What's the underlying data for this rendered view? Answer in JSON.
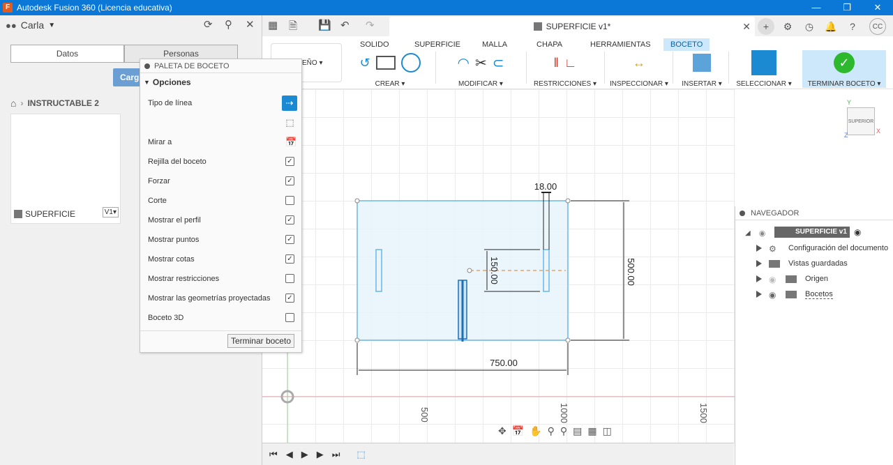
{
  "window": {
    "title": "Autodesk Fusion 360 (Licencia educativa)",
    "logo": "F",
    "minimize": "—",
    "maximize": "❐",
    "close": "✕"
  },
  "left_panel": {
    "user": "Carla",
    "tabs": [
      "Datos",
      "Personas"
    ],
    "upload_label": "Carg",
    "breadcrumb": "INSTRUCTABLE 2",
    "card": {
      "name": "SUPERFICIE",
      "version": "V1▾"
    }
  },
  "palette": {
    "title": "PALETA DE BOCETO",
    "section": "Opciones",
    "rows": [
      {
        "label": "Tipo de línea",
        "state": "button"
      },
      {
        "label": "",
        "state": "icon"
      },
      {
        "label": "Mirar a",
        "state": "icon"
      },
      {
        "label": "Rejilla del boceto",
        "state": "checked"
      },
      {
        "label": "Forzar",
        "state": "checked"
      },
      {
        "label": "Corte",
        "state": "unchecked"
      },
      {
        "label": "Mostrar el perfil",
        "state": "checked"
      },
      {
        "label": "Mostrar puntos",
        "state": "checked"
      },
      {
        "label": "Mostrar cotas",
        "state": "checked"
      },
      {
        "label": "Mostrar restricciones",
        "state": "unchecked"
      },
      {
        "label": "Mostrar las geometrías proyectadas",
        "state": "checked"
      },
      {
        "label": "Boceto 3D",
        "state": "unchecked"
      }
    ],
    "finish": "Terminar boceto"
  },
  "document": {
    "tab_title": "SUPERFICIE v1*"
  },
  "ribbon": {
    "design": "EÑO ▾",
    "tabs": [
      "SOLIDO",
      "SUPERFICIE",
      "MALLA",
      "CHAPA",
      "HERRAMIENTAS",
      "BOCETO"
    ],
    "active_tab": "BOCETO",
    "groups": [
      "CREAR ▾",
      "MODIFICAR ▾",
      "RESTRICCIONES ▾",
      "INSPECCIONAR ▾",
      "INSERTAR ▾",
      "SELECCIONAR ▾",
      "TERMINAR BOCETO ▾"
    ]
  },
  "sketch": {
    "dim_width": "750.00",
    "dim_height": "500.00",
    "dim_slot": "18.00",
    "dim_offset": "150.00",
    "axis_labels": [
      "500",
      "1000",
      "1500"
    ]
  },
  "viewcube": {
    "label": "SUPERIOR",
    "x": "X",
    "y": "Y",
    "z": "Z"
  },
  "navigator": {
    "title": "NAVEGADOR",
    "root": "SUPERFICIE v1",
    "items": [
      "Configuración del documento",
      "Vistas guardadas",
      "Origen",
      "Bocetos"
    ]
  },
  "colors": {
    "accent": "#0b78d7",
    "sketch_fill": "#e6f3fb",
    "sketch_line": "#6ab7e6",
    "dim_line": "#222222"
  }
}
